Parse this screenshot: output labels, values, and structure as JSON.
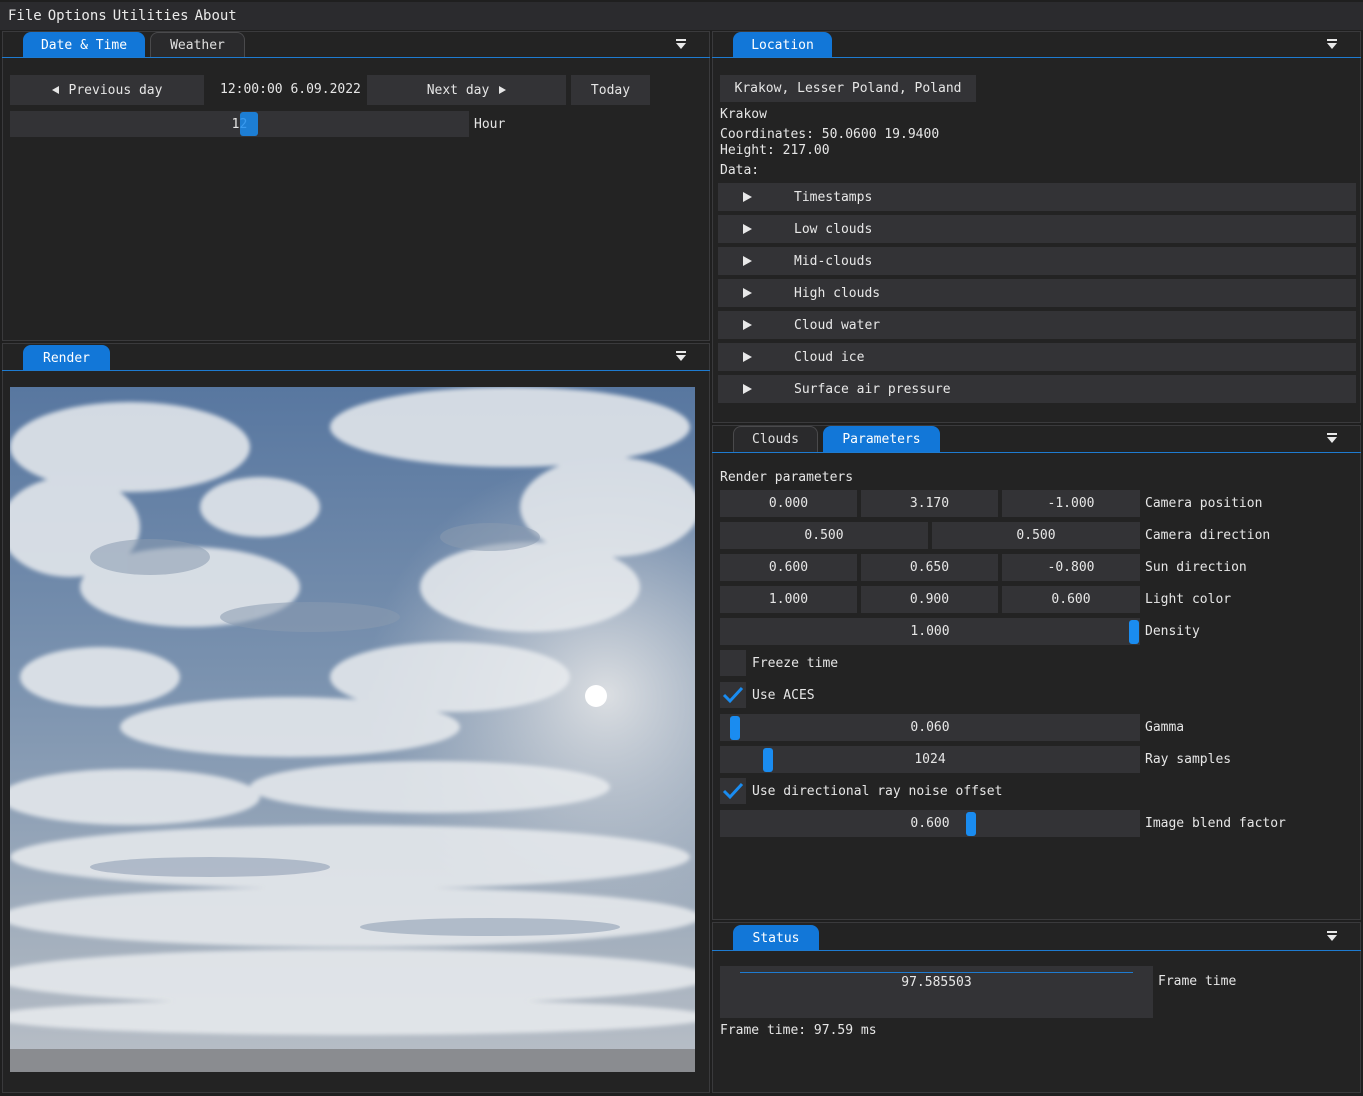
{
  "menu": [
    "File",
    "Options",
    "Utilities",
    "About"
  ],
  "datetime_panel": {
    "tabs": [
      "Date & Time",
      "Weather"
    ],
    "prev_day": "Previous day",
    "current": "12:00:00 6.09.2022",
    "next_day": "Next day",
    "today": "Today",
    "hour_value": "12",
    "hour_label": "Hour"
  },
  "render_panel": {
    "tab": "Render"
  },
  "location_panel": {
    "tab": "Location",
    "location_button": "Krakow, Lesser Poland, Poland",
    "city": "Krakow",
    "coordinates": "Coordinates: 50.0600 19.9400",
    "height": "Height: 217.00",
    "data_label": "Data:",
    "items": [
      "Timestamps",
      "Low clouds",
      "Mid-clouds",
      "High clouds",
      "Cloud water",
      "Cloud ice",
      "Surface air pressure"
    ]
  },
  "params_panel": {
    "tabs": [
      "Clouds",
      "Parameters"
    ],
    "section": "Render parameters",
    "camera_position": {
      "values": [
        "0.000",
        "3.170",
        "-1.000"
      ],
      "label": "Camera position"
    },
    "camera_direction": {
      "values": [
        "0.500",
        "0.500"
      ],
      "label": "Camera direction"
    },
    "sun_direction": {
      "values": [
        "0.600",
        "0.650",
        "-0.800"
      ],
      "label": "Sun direction"
    },
    "light_color": {
      "values": [
        "1.000",
        "0.900",
        "0.600"
      ],
      "label": "Light color"
    },
    "density": {
      "value": "1.000",
      "label": "Density"
    },
    "freeze_time": {
      "label": "Freeze time",
      "checked": false
    },
    "use_aces": {
      "label": "Use ACES",
      "checked": true
    },
    "gamma": {
      "value": "0.060",
      "label": "Gamma"
    },
    "ray_samples": {
      "value": "1024",
      "label": "Ray samples"
    },
    "ray_noise": {
      "label": "Use directional ray noise offset",
      "checked": true
    },
    "blend": {
      "value": "0.600",
      "label": "Image blend factor"
    }
  },
  "status_panel": {
    "tab": "Status",
    "frame_value": "97.585503",
    "frame_label": "Frame time",
    "frame_text": "Frame time: 97.59 ms"
  },
  "colors": {
    "accent": "#1277d8",
    "grab": "#1a8cf0",
    "frame": "#333336",
    "background": "#232323"
  }
}
